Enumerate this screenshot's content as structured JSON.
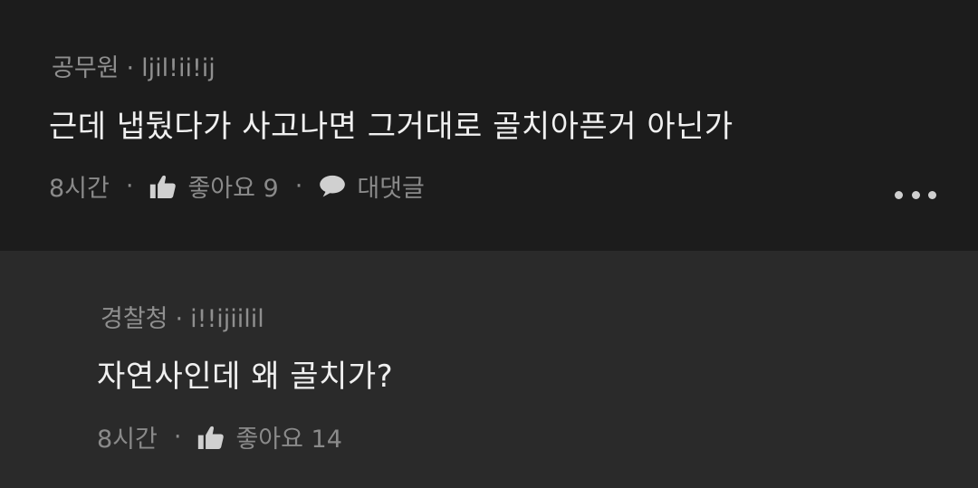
{
  "comments": [
    {
      "author_title": "공무원",
      "separator": "·",
      "nickname": "ljil!ii!ij",
      "text": "근데 냅뒀다가 사고나면 그거대로 골치아픈거 아닌가",
      "time": "8시간",
      "likes_label": "좋아요 9",
      "reply_label": "대댓글",
      "icons": [
        "thumbs-up-icon",
        "speech-bubble-icon",
        "more-dots-icon"
      ]
    },
    {
      "author_title": "경찰청",
      "separator": "·",
      "nickname": "i!!ijiilil",
      "text": "자연사인데 왜 골치가?",
      "time": "8시간",
      "likes_label": "좋아요 14",
      "icons": [
        "thumbs-up-icon"
      ]
    }
  ],
  "colors": {
    "background_top": "#1c1c1c",
    "background_reply": "#2a2a2a",
    "meta_text": "#8f8f8f",
    "body_text": "#f0f0f0"
  }
}
